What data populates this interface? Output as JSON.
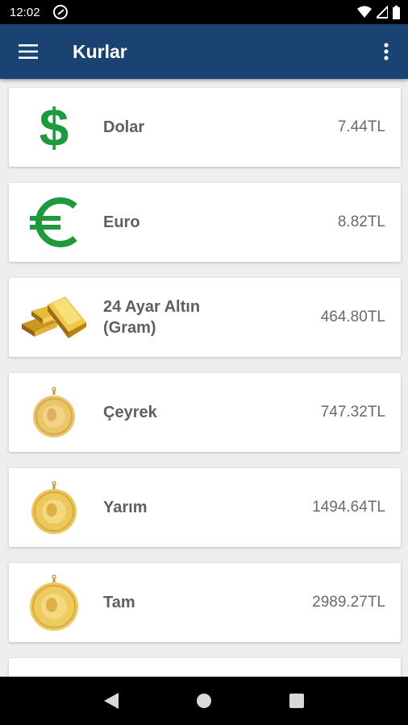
{
  "status_bar": {
    "time": "12:02"
  },
  "app_bar": {
    "title": "Kurlar",
    "color": "#1a4373"
  },
  "rates": [
    {
      "icon": "dollar-icon",
      "name": "Dolar",
      "price": "7.44TL"
    },
    {
      "icon": "euro-icon",
      "name": "Euro",
      "price": "8.82TL"
    },
    {
      "icon": "gold-bars-icon",
      "name": "24 Ayar Altın (Gram)",
      "price": "464.80TL"
    },
    {
      "icon": "gold-coin-icon",
      "name": "Çeyrek",
      "price": "747.32TL"
    },
    {
      "icon": "gold-coin-icon",
      "name": "Yarım",
      "price": "1494.64TL"
    },
    {
      "icon": "gold-coin-icon",
      "name": "Tam",
      "price": "2989.27TL"
    }
  ],
  "colors": {
    "dollar_green": "#1e9a3c",
    "gold": "#e8c25a"
  }
}
